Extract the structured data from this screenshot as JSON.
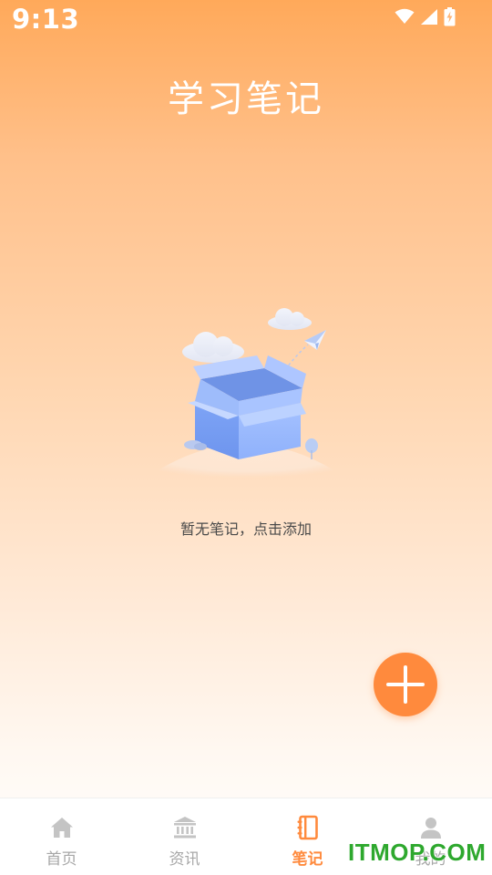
{
  "status_bar": {
    "time": "9:13",
    "icons": [
      "wifi-icon",
      "signal-icon",
      "battery-charging-icon"
    ]
  },
  "page": {
    "title": "学习笔记"
  },
  "empty_state": {
    "message": "暂无笔记，点击添加",
    "illustration": "empty-box-illustration"
  },
  "fab": {
    "icon": "plus-icon",
    "color": "#ff8a3d"
  },
  "tab_bar": {
    "active_index": 2,
    "active_color": "#ff8a3d",
    "inactive_color": "#a7a7a7",
    "items": [
      {
        "label": "首页",
        "icon": "home-icon"
      },
      {
        "label": "资讯",
        "icon": "bank-icon"
      },
      {
        "label": "笔记",
        "icon": "notebook-icon"
      },
      {
        "label": "我的",
        "icon": "user-icon"
      }
    ]
  },
  "watermark": {
    "text": "ITMOP.COM"
  }
}
